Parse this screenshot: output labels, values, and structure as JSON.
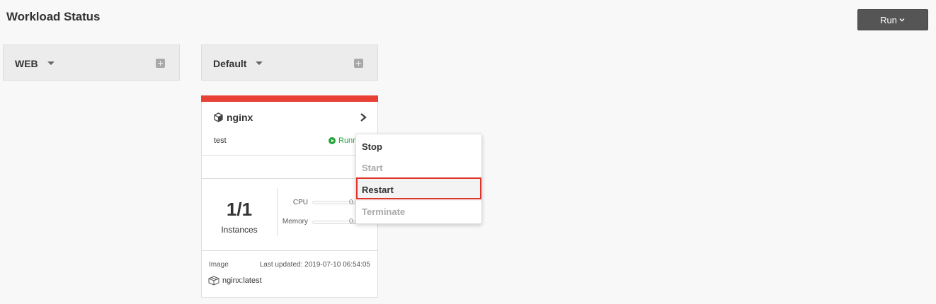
{
  "page": {
    "title": "Workload Status"
  },
  "toolbar": {
    "run_label": "Run"
  },
  "groups": [
    {
      "name": "WEB"
    },
    {
      "name": "Default"
    }
  ],
  "workload": {
    "name": "nginx",
    "description": "test",
    "status": "Running",
    "status_color": "#27a53c",
    "strip_color": "#e84034",
    "instances": "1/1",
    "instances_label": "Instances",
    "metrics": {
      "cpu_label": "CPU",
      "cpu_value": "0.0",
      "memory_label": "Memory",
      "memory_value": "0.0"
    },
    "image_label": "Image",
    "last_updated": "Last updated: 2019-07-10 06:54:05",
    "image": "nginx:latest"
  },
  "context_menu": {
    "items": [
      {
        "label": "Stop",
        "enabled": true
      },
      {
        "label": "Start",
        "enabled": false
      },
      {
        "label": "Restart",
        "enabled": true,
        "highlighted": true
      },
      {
        "label": "Terminate",
        "enabled": false
      }
    ],
    "highlight_color": "#e0342a"
  }
}
